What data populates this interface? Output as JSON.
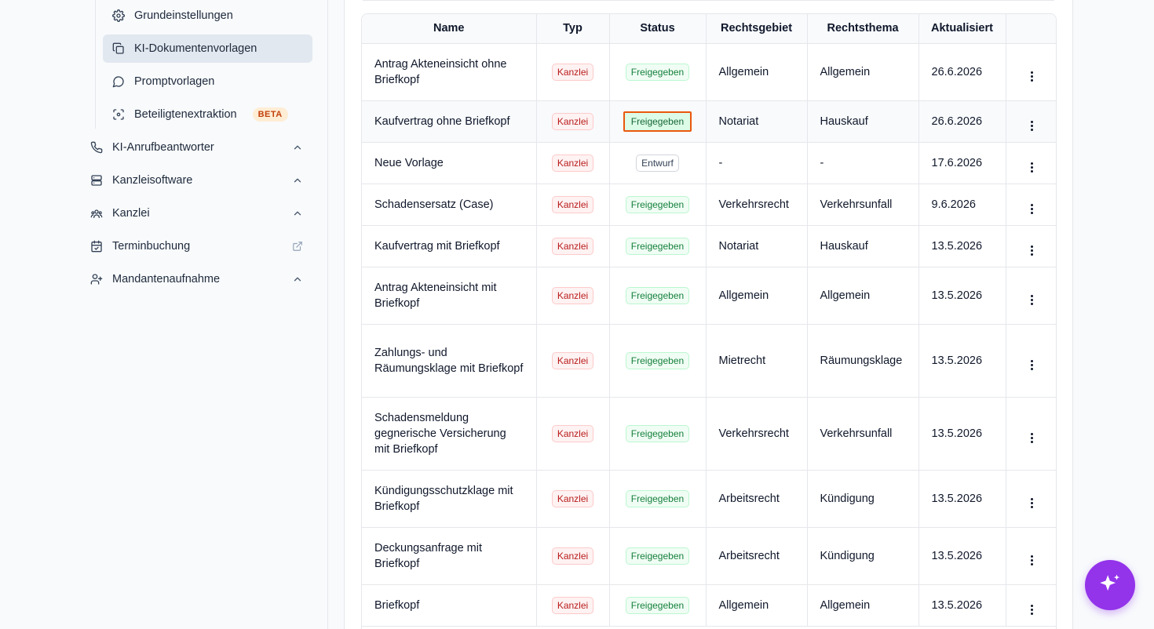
{
  "sidebar": {
    "sub_items": [
      {
        "label": "Grundeinstellungen",
        "icon": "gear-icon"
      },
      {
        "label": "KI-Dokumentenvorlagen",
        "icon": "copy-icon",
        "active": true
      },
      {
        "label": "Promptvorlagen",
        "icon": "message-circle-icon"
      },
      {
        "label": "Beteiligtenextraktion",
        "icon": "scan-face-icon",
        "badge": "BETA"
      }
    ],
    "items": [
      {
        "label": "KI-Anrufbeantworter",
        "icon": "phone-icon",
        "trail": "chevron-up-icon"
      },
      {
        "label": "Kanzleisoftware",
        "icon": "server-icon",
        "trail": "chevron-up-icon"
      },
      {
        "label": "Kanzlei",
        "icon": "users-icon",
        "trail": "chevron-up-icon"
      },
      {
        "label": "Terminbuchung",
        "icon": "calendar-check-icon",
        "trail": "external-link-icon"
      },
      {
        "label": "Mandantenaufnahme",
        "icon": "user-plus-icon",
        "trail": "chevron-up-icon"
      }
    ]
  },
  "table": {
    "headers": [
      "Name",
      "Typ",
      "Status",
      "Rechtsgebiet",
      "Rechtsthema",
      "Aktualisiert",
      ""
    ],
    "rows": [
      {
        "name": "Antrag Akteneinsicht ohne Briefkopf",
        "typ": "Kanzlei",
        "status": "Freigegeben",
        "gebiet": "Allgemein",
        "thema": "Allgemein",
        "datum": "26.6.2026"
      },
      {
        "name": "Kaufvertrag ohne Briefkopf",
        "typ": "Kanzlei",
        "status": "Freigegeben",
        "gebiet": "Notariat",
        "thema": "Hauskauf",
        "datum": "26.6.2026",
        "highlight": true
      },
      {
        "name": "Neue Vorlage",
        "typ": "Kanzlei",
        "status": "Entwurf",
        "gebiet": "-",
        "thema": "-",
        "datum": "17.6.2026"
      },
      {
        "name": "Schadensersatz (Case)",
        "typ": "Kanzlei",
        "status": "Freigegeben",
        "gebiet": "Verkehrsrecht",
        "thema": "Verkehrsunfall",
        "datum": "9.6.2026"
      },
      {
        "name": "Kaufvertrag mit Briefkopf",
        "typ": "Kanzlei",
        "status": "Freigegeben",
        "gebiet": "Notariat",
        "thema": "Hauskauf",
        "datum": "13.5.2026"
      },
      {
        "name": "Antrag Akteneinsicht mit Briefkopf",
        "typ": "Kanzlei",
        "status": "Freigegeben",
        "gebiet": "Allgemein",
        "thema": "Allgemein",
        "datum": "13.5.2026"
      },
      {
        "name": "Zahlungs- und Räumungsklage mit Briefkopf",
        "typ": "Kanzlei",
        "status": "Freigegeben",
        "gebiet": "Mietrecht",
        "thema": "Räumungsklage",
        "datum": "13.5.2026"
      },
      {
        "name": "Schadensmeldung gegnerische Versicherung mit Briefkopf",
        "typ": "Kanzlei",
        "status": "Freigegeben",
        "gebiet": "Verkehrsrecht",
        "thema": "Verkehrsunfall",
        "datum": "13.5.2026"
      },
      {
        "name": "Kündigungsschutzklage mit Briefkopf",
        "typ": "Kanzlei",
        "status": "Freigegeben",
        "gebiet": "Arbeitsrecht",
        "thema": "Kündigung",
        "datum": "13.5.2026"
      },
      {
        "name": "Deckungsanfrage mit Briefkopf",
        "typ": "Kanzlei",
        "status": "Freigegeben",
        "gebiet": "Arbeitsrecht",
        "thema": "Kündigung",
        "datum": "13.5.2026"
      },
      {
        "name": "Briefkopf",
        "typ": "Kanzlei",
        "status": "Freigegeben",
        "gebiet": "Allgemein",
        "thema": "Allgemein",
        "datum": "13.5.2026"
      }
    ]
  },
  "fab": {
    "icon": "sparkles-icon"
  },
  "colors": {
    "accent": "#9333ea",
    "selection_outline": "#ea580c",
    "typ_badge": "#b91c1c",
    "status_badge": "#15803d"
  }
}
